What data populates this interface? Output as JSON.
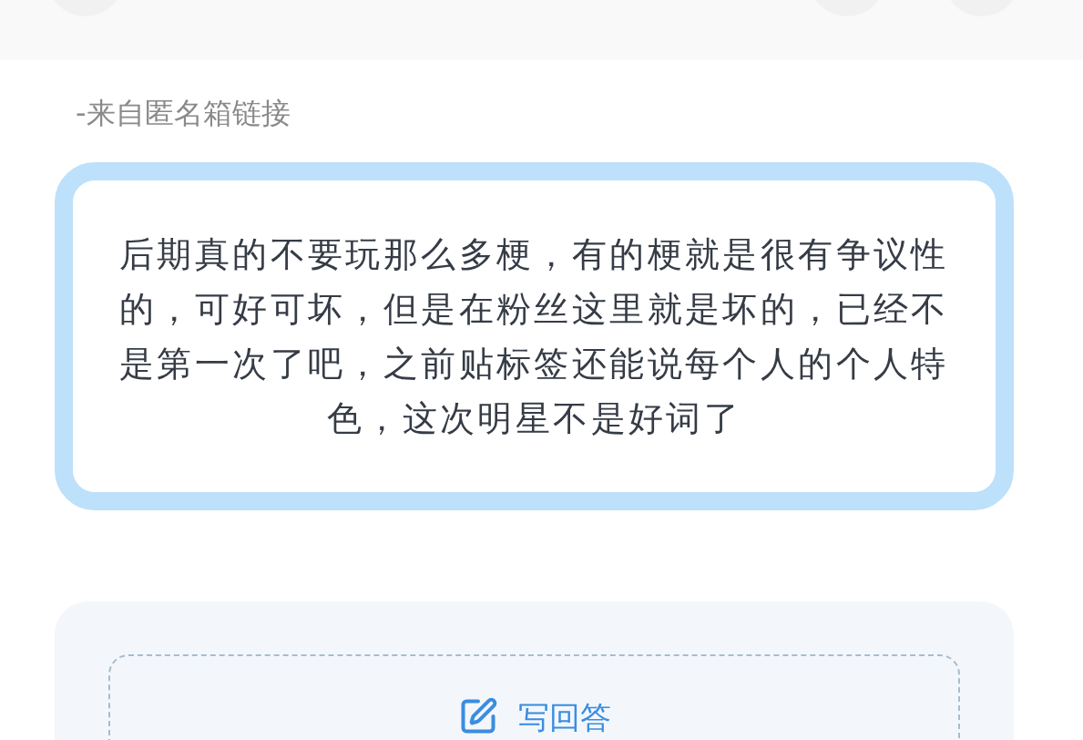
{
  "source": "-来自匿名箱链接",
  "question": {
    "text": "后期真的不要玩那么多梗，有的梗就是很有争议性的，可好可坏，但是在粉丝这里就是坏的，已经不是第一次了吧，之前贴标签还能说每个人的个人特色，这次明星不是好词了"
  },
  "answer_button": {
    "label": "写回答"
  }
}
